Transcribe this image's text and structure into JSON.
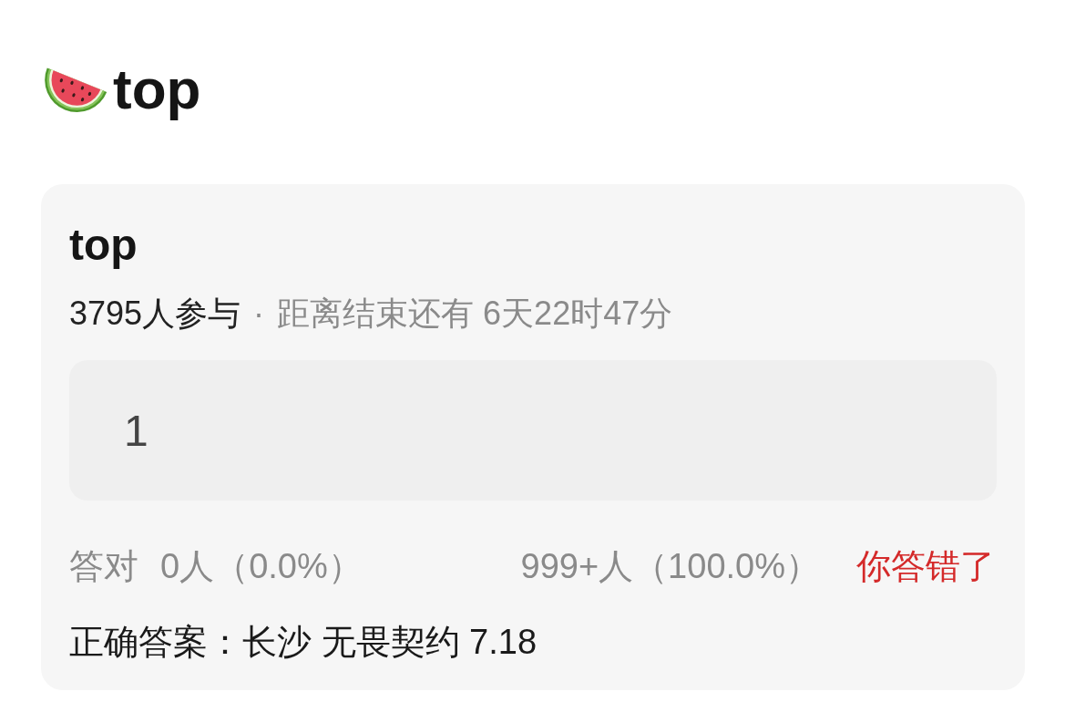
{
  "header": {
    "title": "top"
  },
  "poll": {
    "title": "top",
    "participants": "3795人参与",
    "separator": "·",
    "countdown": "距离结束还有 6天22时47分",
    "your_answer": "1",
    "correct_label": "答对",
    "correct_count": "0人（0.0%）",
    "wrong_count": "999+人（100.0%）",
    "verdict": {
      "text": "你答错了",
      "is_correct": false
    },
    "correct_answer": "正确答案：长沙 无畏契约 7.18"
  }
}
